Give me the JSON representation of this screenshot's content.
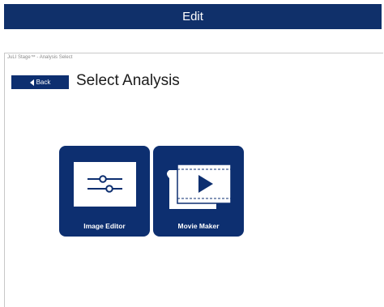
{
  "header": {
    "title": "Edit"
  },
  "window": {
    "title": "JuLI Stage™ - Analysis Select"
  },
  "nav": {
    "back_label": "Back"
  },
  "page": {
    "title": "Select Analysis"
  },
  "tiles": [
    {
      "label": "Image Editor",
      "icon": "sliders-icon"
    },
    {
      "label": "Movie Maker",
      "icon": "film-play-icon"
    }
  ],
  "colors": {
    "brand": "#0d2f70",
    "header": "#10306a"
  }
}
